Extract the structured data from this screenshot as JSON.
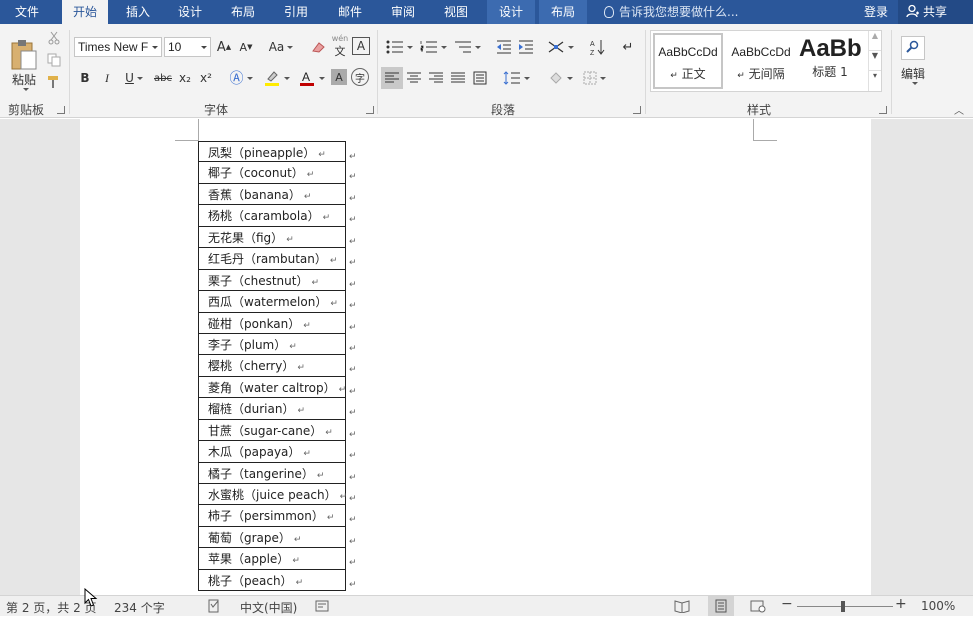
{
  "tabs": {
    "file": "文件",
    "home": "开始",
    "insert": "插入",
    "design": "设计",
    "layout": "布局",
    "references": "引用",
    "mailings": "邮件",
    "review": "审阅",
    "view": "视图",
    "table_design": "设计",
    "table_layout": "布局"
  },
  "tell_me": "告诉我您想要做什么...",
  "login": "登录",
  "share": "共享",
  "ribbon": {
    "clipboard": {
      "paste_label": "粘贴",
      "group_label": "剪贴板"
    },
    "font": {
      "font_name": "Times New F",
      "font_size": "10",
      "group_label": "字体",
      "bold": "B",
      "italic": "I",
      "underline": "U",
      "strike": "abc",
      "subscript": "x₂",
      "superscript": "x²",
      "grow": "A",
      "shrink": "A",
      "change_case": "Aa",
      "wen": "wén",
      "char_border": "A",
      "char_shading": "A",
      "enclose": "字"
    },
    "paragraph": {
      "group_label": "段落"
    },
    "styles": {
      "group_label": "样式",
      "items": [
        {
          "sample": "AaBbCcDd",
          "name": "正文"
        },
        {
          "sample": "AaBbCcDd",
          "name": "无间隔"
        },
        {
          "sample": "AaBb",
          "name": "标题 1"
        }
      ]
    },
    "editing": {
      "label": "编辑"
    }
  },
  "document": {
    "rows": [
      "凤梨（pineapple）",
      "椰子（coconut）",
      "香蕉（banana）",
      "杨桃（carambola）",
      "无花果（fig）",
      "红毛丹（rambutan）",
      "栗子（chestnut）",
      "西瓜（watermelon）",
      "碰柑（ponkan）",
      "李子（plum）",
      "樱桃（cherry）",
      "菱角（water caltrop）",
      "榴梿（durian）",
      "甘蔗（sugar-cane）",
      "木瓜（papaya）",
      "橘子（tangerine）",
      "水蜜桃（juice peach）",
      "柿子（persimmon）",
      "葡萄（grape）",
      "苹果（apple）",
      "桃子（peach）"
    ],
    "para_mark": "↵"
  },
  "status": {
    "page": "第 2 页，共 2 页",
    "words": "234 个字",
    "language": "中文(中国)",
    "zoom": "100%",
    "zoom_minus": "−",
    "zoom_plus": "+"
  },
  "colors": {
    "brand": "#2b579a",
    "ribbon_bg": "#f3f3f3",
    "doc_bg": "#e6e6e6"
  }
}
